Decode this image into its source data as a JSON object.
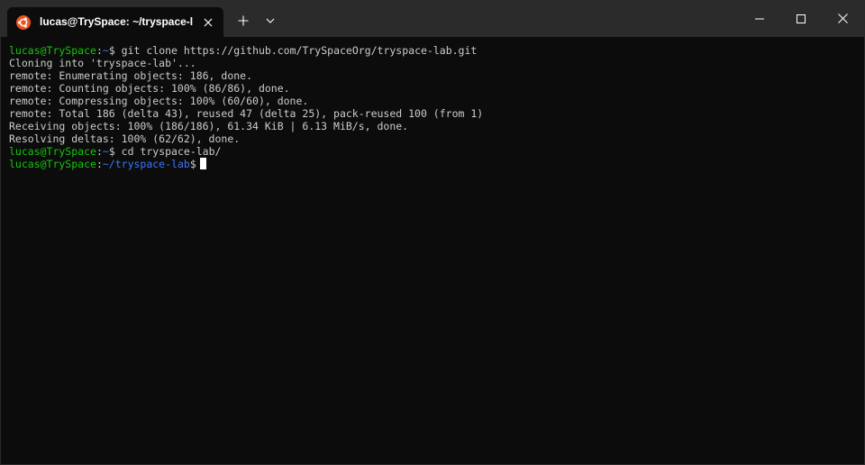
{
  "tab": {
    "title": "lucas@TrySpace: ~/tryspace-l",
    "icon": "ubuntu-icon",
    "icon_color": "#e95420"
  },
  "colors": {
    "prompt_user": "#16c60c",
    "prompt_path": "#3b78ff",
    "text": "#cccccc",
    "background": "#0c0c0c",
    "titlebar": "#2b2b2b"
  },
  "terminal": {
    "lines": [
      {
        "type": "prompt",
        "user": "lucas@TrySpace",
        "sep": ":",
        "path": "~",
        "dollar": "$",
        "cmd": " git clone https://github.com/TrySpaceOrg/tryspace-lab.git"
      },
      {
        "type": "output",
        "text": "Cloning into 'tryspace-lab'..."
      },
      {
        "type": "output",
        "text": "remote: Enumerating objects: 186, done."
      },
      {
        "type": "output",
        "text": "remote: Counting objects: 100% (86/86), done."
      },
      {
        "type": "output",
        "text": "remote: Compressing objects: 100% (60/60), done."
      },
      {
        "type": "output",
        "text": "remote: Total 186 (delta 43), reused 47 (delta 25), pack-reused 100 (from 1)"
      },
      {
        "type": "output",
        "text": "Receiving objects: 100% (186/186), 61.34 KiB | 6.13 MiB/s, done."
      },
      {
        "type": "output",
        "text": "Resolving deltas: 100% (62/62), done."
      },
      {
        "type": "prompt",
        "user": "lucas@TrySpace",
        "sep": ":",
        "path": "~",
        "dollar": "$",
        "cmd": " cd tryspace-lab/"
      },
      {
        "type": "prompt",
        "user": "lucas@TrySpace",
        "sep": ":",
        "path": "~/tryspace-lab",
        "dollar": "$",
        "cmd": ""
      }
    ]
  }
}
